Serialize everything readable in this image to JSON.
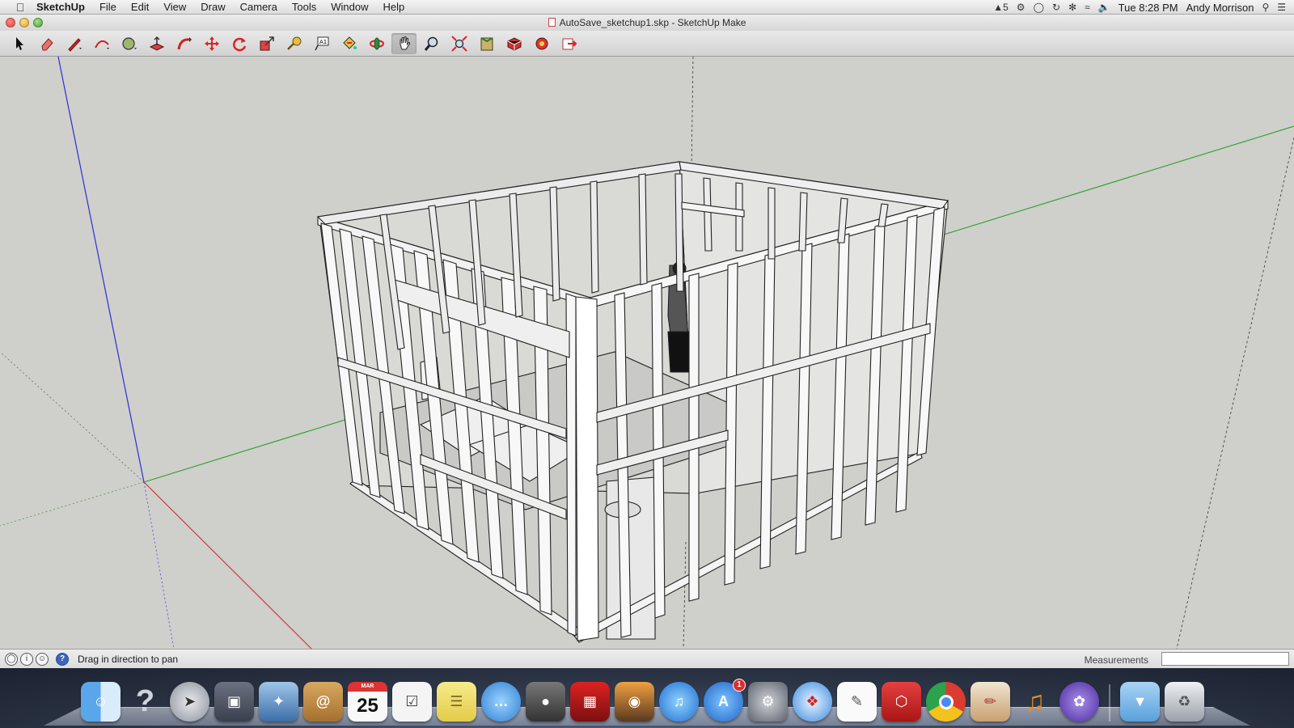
{
  "menubar": {
    "app_name": "SketchUp",
    "items": [
      "File",
      "Edit",
      "View",
      "Draw",
      "Camera",
      "Tools",
      "Window",
      "Help"
    ],
    "adobe_count": "5",
    "clock": "Tue 8:28 PM",
    "user": "Andy Morrison"
  },
  "window": {
    "title": "AutoSave_sketchup1.skp - SketchUp Make"
  },
  "toolbar": {
    "tools": [
      "select-tool",
      "eraser-tool",
      "line-tool",
      "arc-tool",
      "circle-tool",
      "push-pull-tool",
      "follow-me-tool",
      "move-tool",
      "rotate-tool",
      "scale-tool",
      "tape-measure-tool",
      "text-tool",
      "paint-bucket-tool",
      "orbit-tool",
      "pan-tool",
      "zoom-tool",
      "zoom-extents-tool",
      "warehouse-tool",
      "components-tool",
      "extension-tool",
      "export-tool"
    ],
    "active_tool": "pan-tool"
  },
  "statusbar": {
    "hint": "Drag in direction to pan",
    "measurements_label": "Measurements",
    "measurements_value": ""
  },
  "dock": {
    "apps": [
      "Finder",
      "Help",
      "Launchpad",
      "Photo Booth",
      "Mail",
      "Contacts",
      "Calendar",
      "Reminders",
      "Notes",
      "Messages",
      "FaceTime",
      "Photo Booth Red",
      "iPhoto",
      "iTunes",
      "App Store",
      "System Preferences",
      "Safari",
      "TextEdit",
      "SketchUp",
      "Chrome",
      "Pencil",
      "GarageBand",
      "BitTorrent",
      "Downloads",
      "Trash"
    ],
    "calendar_month": "MAR",
    "calendar_day": "25",
    "app_store_badge": "1"
  }
}
